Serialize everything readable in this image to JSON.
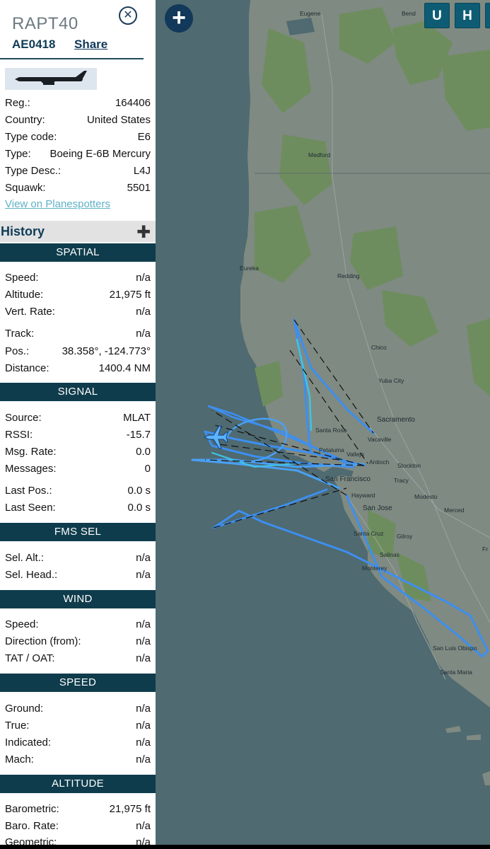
{
  "aircraft": {
    "callsign": "RAPT40",
    "hex": "AE0418",
    "share_label": "Share",
    "close_icon": "⊗",
    "photo_alt": "aircraft-photo"
  },
  "details": [
    {
      "label": "Reg.:",
      "value": "164406"
    },
    {
      "label": "Country:",
      "value": "United States"
    },
    {
      "label": "Type code:",
      "value": "E6"
    },
    {
      "label": "Type:",
      "value": "Boeing E-6B Mercury"
    },
    {
      "label": "Type Desc.:",
      "value": "L4J"
    },
    {
      "label": "Squawk:",
      "value": "5501"
    }
  ],
  "planespotters_link": "View on Planespotters",
  "history": {
    "label": "History",
    "plus": "✚"
  },
  "sections": {
    "spatial": {
      "title": "SPATIAL",
      "rows": [
        {
          "label": "Speed:",
          "value": "n/a"
        },
        {
          "label": "Altitude:",
          "value": "21,975 ft"
        },
        {
          "label": "Vert. Rate:",
          "value": "n/a"
        },
        {
          "label": "Track:",
          "value": "n/a"
        },
        {
          "label": "Pos.:",
          "value": "38.358°, -124.773°"
        },
        {
          "label": "Distance:",
          "value": "1400.4 NM"
        }
      ]
    },
    "signal": {
      "title": "SIGNAL",
      "rows": [
        {
          "label": "Source:",
          "value": "MLAT"
        },
        {
          "label": "RSSI:",
          "value": "-15.7"
        },
        {
          "label": "Msg. Rate:",
          "value": "0.0"
        },
        {
          "label": "Messages:",
          "value": "0"
        },
        {
          "label": "Last Pos.:",
          "value": "0.0 s"
        },
        {
          "label": "Last Seen:",
          "value": "0.0 s"
        }
      ]
    },
    "fms": {
      "title": "FMS SEL",
      "rows": [
        {
          "label": "Sel. Alt.:",
          "value": "n/a"
        },
        {
          "label": "Sel. Head.:",
          "value": "n/a"
        }
      ]
    },
    "wind": {
      "title": "WIND",
      "rows": [
        {
          "label": "Speed:",
          "value": "n/a"
        },
        {
          "label": "Direction (from):",
          "value": "n/a"
        },
        {
          "label": "TAT / OAT:",
          "value": "n/a"
        }
      ]
    },
    "speed": {
      "title": "SPEED",
      "rows": [
        {
          "label": "Ground:",
          "value": "n/a"
        },
        {
          "label": "True:",
          "value": "n/a"
        },
        {
          "label": "Indicated:",
          "value": "n/a"
        },
        {
          "label": "Mach:",
          "value": "n/a"
        }
      ]
    },
    "altitude": {
      "title": "ALTITUDE",
      "rows": [
        {
          "label": "Barometric:",
          "value": "21,975 ft"
        },
        {
          "label": "Baro. Rate:",
          "value": "n/a"
        },
        {
          "label": "Geometric:",
          "value": "n/a"
        }
      ]
    }
  },
  "map": {
    "zoom_icon": "+",
    "buttons": [
      "U",
      "H"
    ],
    "cities": [
      "Eugene",
      "Bend",
      "Medford",
      "Eureka",
      "Redding",
      "Chico",
      "Yuba City",
      "Sacramento",
      "Santa Rosa",
      "Vacaville",
      "Petaluma",
      "Vallejo",
      "Antioch",
      "Stockton",
      "San Francisco",
      "Tracy",
      "Hayward",
      "Modesto",
      "San Jose",
      "Merced",
      "Santa Cruz",
      "Gilroy",
      "Salinas",
      "Monterey",
      "San Luis Obispo",
      "Santa Maria",
      "Fr"
    ],
    "colors": {
      "water": "#4f6a70",
      "land": "#7f8a82",
      "track": "#3d8ff0",
      "track_light": "#3fc4e6",
      "dashed": "#111111",
      "aircraft": "#5ab4ff"
    }
  }
}
